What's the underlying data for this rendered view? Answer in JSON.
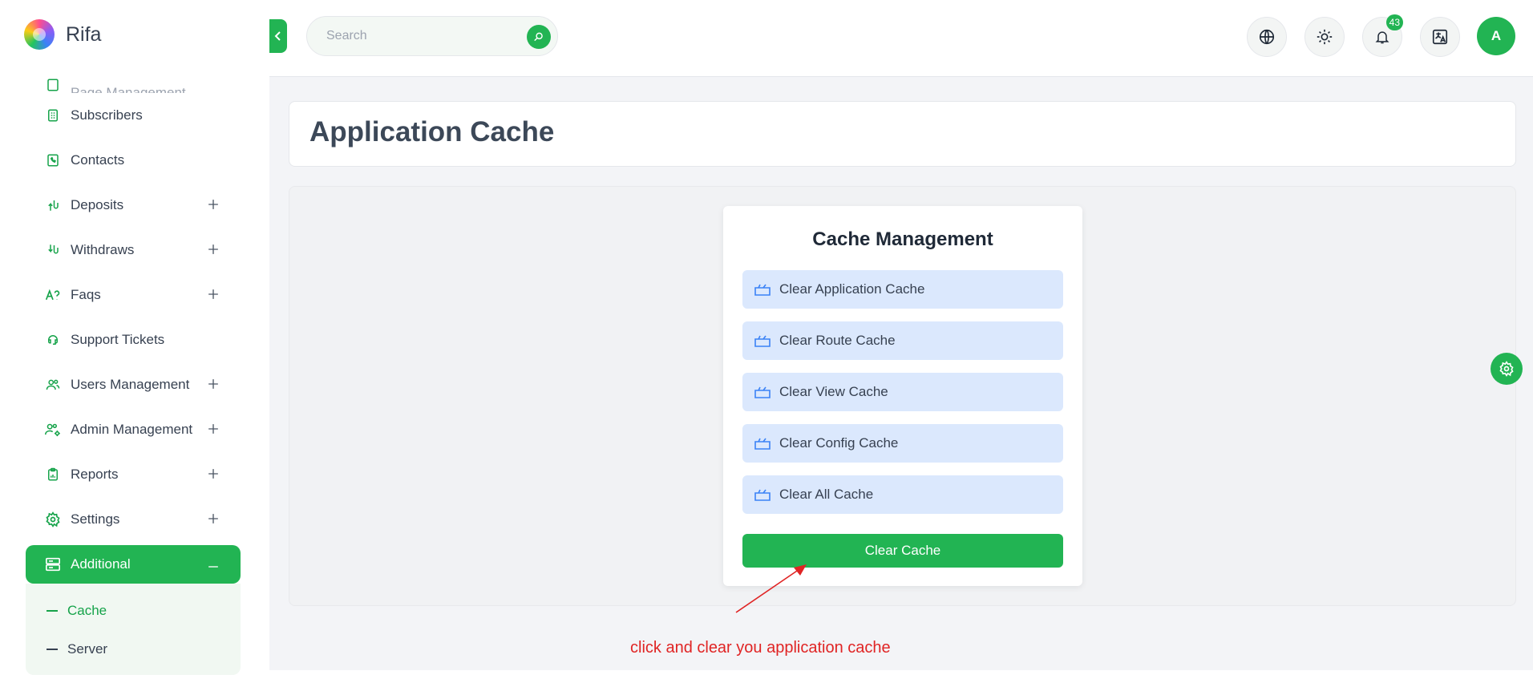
{
  "brand": {
    "name": "Rifa"
  },
  "sidebar": {
    "partial_label": "Page Management",
    "items": [
      {
        "label": "Subscribers",
        "icon": "subscribers-icon",
        "expandable": false
      },
      {
        "label": "Contacts",
        "icon": "contacts-icon",
        "expandable": false
      },
      {
        "label": "Deposits",
        "icon": "deposits-icon",
        "expandable": true
      },
      {
        "label": "Withdraws",
        "icon": "withdraws-icon",
        "expandable": true
      },
      {
        "label": "Faqs",
        "icon": "faqs-icon",
        "expandable": true
      },
      {
        "label": "Support Tickets",
        "icon": "support-icon",
        "expandable": false
      },
      {
        "label": "Users Management",
        "icon": "users-icon",
        "expandable": true
      },
      {
        "label": "Admin Management",
        "icon": "admin-icon",
        "expandable": true
      },
      {
        "label": "Reports",
        "icon": "reports-icon",
        "expandable": true
      },
      {
        "label": "Settings",
        "icon": "settings-icon",
        "expandable": true
      }
    ],
    "active_item": {
      "label": "Additional",
      "icon": "server-icon"
    },
    "submenu": [
      {
        "label": "Cache",
        "active": true
      },
      {
        "label": "Server",
        "active": false
      }
    ]
  },
  "topbar": {
    "search_placeholder": "Search",
    "notification_count": "43",
    "avatar_initial": "A"
  },
  "page": {
    "title": "Application Cache"
  },
  "cache": {
    "heading": "Cache Management",
    "options": [
      {
        "label": "Clear Application Cache"
      },
      {
        "label": "Clear Route Cache"
      },
      {
        "label": "Clear View Cache"
      },
      {
        "label": "Clear Config Cache"
      },
      {
        "label": "Clear All Cache"
      }
    ],
    "button_label": "Clear Cache"
  },
  "annotation": {
    "text": "click and clear you application cache",
    "color": "#e02424"
  },
  "colors": {
    "accent": "#22b453",
    "option_bg": "#dbe8fd"
  }
}
